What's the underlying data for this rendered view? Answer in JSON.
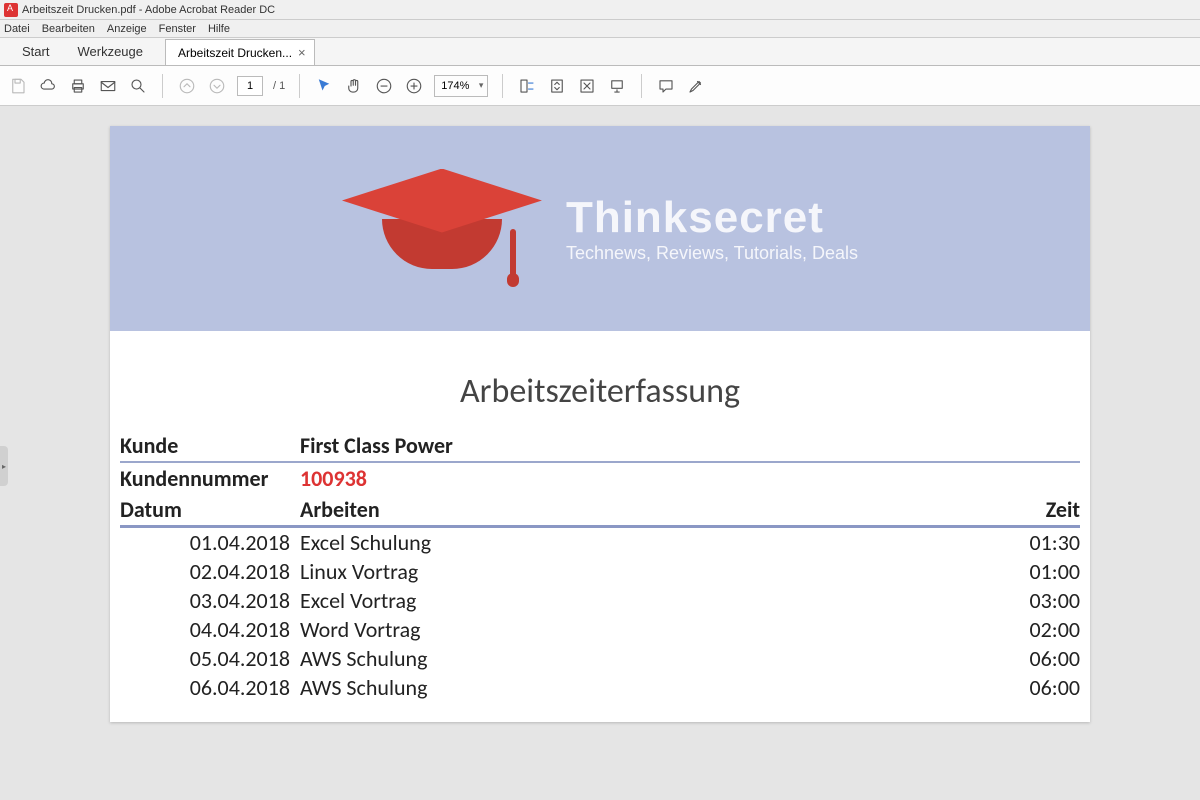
{
  "window": {
    "title": "Arbeitszeit Drucken.pdf - Adobe Acrobat Reader DC"
  },
  "menu": {
    "items": [
      "Datei",
      "Bearbeiten",
      "Anzeige",
      "Fenster",
      "Hilfe"
    ]
  },
  "tabs": {
    "start": "Start",
    "tools": "Werkzeuge",
    "doc": "Arbeitszeit Drucken..."
  },
  "toolbar": {
    "page_current": "1",
    "page_total": "/ 1",
    "zoom": "174%"
  },
  "banner": {
    "title": "Thinksecret",
    "subtitle": "Technews, Reviews, Tutorials, Deals"
  },
  "doc": {
    "title": "Arbeitszeiterfassung",
    "kunde_label": "Kunde",
    "kunde_value": "First Class Power",
    "kundennr_label": "Kundennummer",
    "kundennr_value": "100938",
    "col_datum": "Datum",
    "col_arbeiten": "Arbeiten",
    "col_zeit": "Zeit",
    "rows": [
      {
        "datum": "01.04.2018",
        "arbeit": "Excel Schulung",
        "zeit": "01:30"
      },
      {
        "datum": "02.04.2018",
        "arbeit": "Linux Vortrag",
        "zeit": "01:00"
      },
      {
        "datum": "03.04.2018",
        "arbeit": "Excel Vortrag",
        "zeit": "03:00"
      },
      {
        "datum": "04.04.2018",
        "arbeit": "Word Vortrag",
        "zeit": "02:00"
      },
      {
        "datum": "05.04.2018",
        "arbeit": "AWS Schulung",
        "zeit": "06:00"
      },
      {
        "datum": "06.04.2018",
        "arbeit": "AWS Schulung",
        "zeit": "06:00"
      }
    ]
  }
}
